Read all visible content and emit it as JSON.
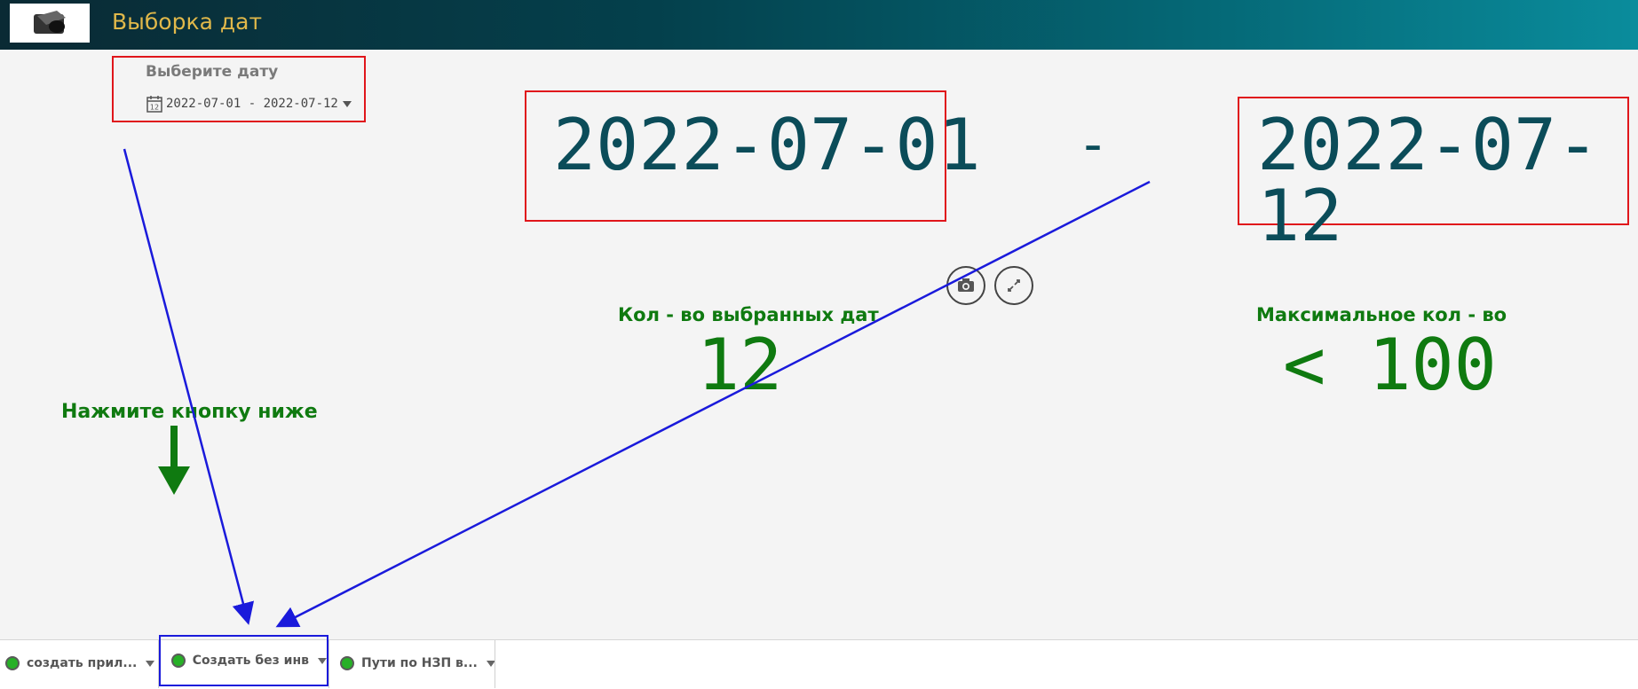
{
  "header": {
    "title": "Выборка дат",
    "logo_icon": "logo-icon"
  },
  "date_picker": {
    "label": "Выберите дату",
    "value": "2022-07-01 - 2022-07-12",
    "icon": "calendar-icon"
  },
  "range": {
    "start": "2022-07-01",
    "separator": "-",
    "end": "2022-07-12"
  },
  "tools": {
    "snapshot_icon": "camera-icon",
    "expand_icon": "expand-icon"
  },
  "kpi_selected": {
    "label": "Кол - во выбранных дат",
    "value": "12"
  },
  "kpi_max": {
    "label": "Максимальное кол - во",
    "value": "< 100"
  },
  "hint": {
    "text": "Нажмите кнопку ниже",
    "icon": "arrow-down-icon"
  },
  "sheets": [
    {
      "label": "создать прил..."
    },
    {
      "label": "Создать без инв"
    },
    {
      "label": "Пути по НЗП в..."
    }
  ],
  "colors": {
    "accent_green": "#0f7a10",
    "date_teal": "#0b4c59",
    "highlight_red": "#e0161b",
    "highlight_blue": "#1a1adb"
  }
}
